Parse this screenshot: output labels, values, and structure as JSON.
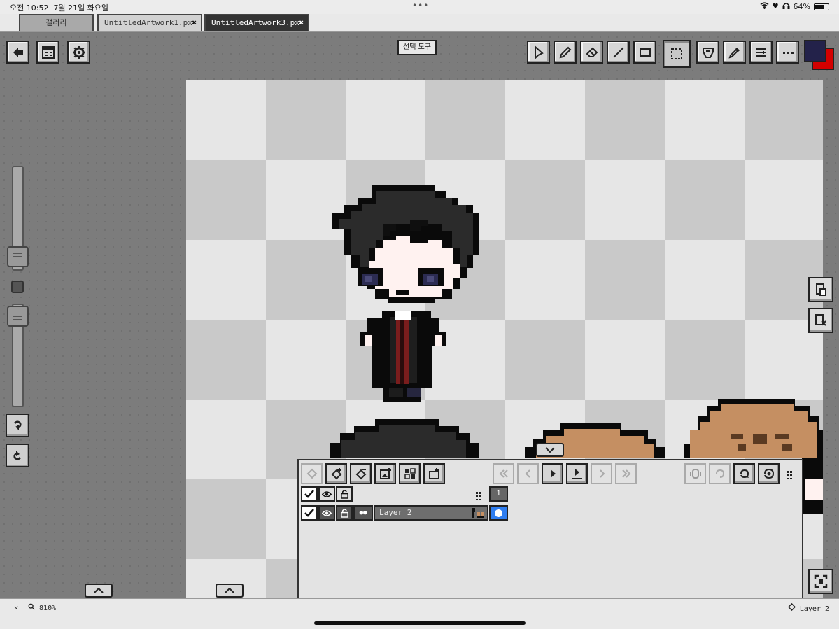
{
  "status_bar": {
    "time": "오전 10:52",
    "date": "7월 21일 화요일",
    "battery_percent": "64%",
    "battery_level": 0.64
  },
  "tabs": [
    {
      "label": "갤러리",
      "active": false
    },
    {
      "label": "UntitledArtwork1.px",
      "active": false,
      "closable": true
    },
    {
      "label": "UntitledArtwork3.px",
      "active": true,
      "closable": true
    }
  ],
  "toolbar": {
    "left_buttons": [
      "back-icon",
      "window-icon",
      "gear-icon"
    ],
    "selection_tool_label": "선택 도구",
    "tools": [
      "move-cursor-icon",
      "pencil-icon",
      "eraser-icon",
      "line-icon",
      "rectangle-icon",
      "selection-icon",
      "fill-bucket-icon",
      "eyedropper-icon",
      "adjust-icon",
      "more-icon"
    ],
    "active_tool": "selection-icon",
    "primary_color": "#23224a",
    "secondary_color": "#d30000"
  },
  "left_panel": {
    "undo_icon": "undo-icon",
    "redo_icon": "redo-icon"
  },
  "right_panel": {
    "buttons": [
      "paste-icon",
      "clear-clipboard-icon"
    ],
    "fit_icon": "fit-screen-icon"
  },
  "layers_panel": {
    "toolbar": [
      "layer-back-icon",
      "add-frame-icon",
      "duplicate-icon",
      "add-image-icon",
      "layer-grid-icon",
      "export-icon"
    ],
    "playback": [
      "first-frame-icon",
      "prev-frame-icon",
      "play-icon",
      "add-frame-marker-icon",
      "next-frame-icon",
      "last-frame-icon"
    ],
    "onion": [
      "onion-icon",
      "loop-icon",
      "rotate-icon",
      "rotate-all-icon"
    ],
    "frame_number": "1",
    "layer": {
      "name": "Layer 2",
      "visible": true,
      "locked": false
    }
  },
  "bottom_bar": {
    "zoom": "810%",
    "current_layer": "Layer 2"
  }
}
